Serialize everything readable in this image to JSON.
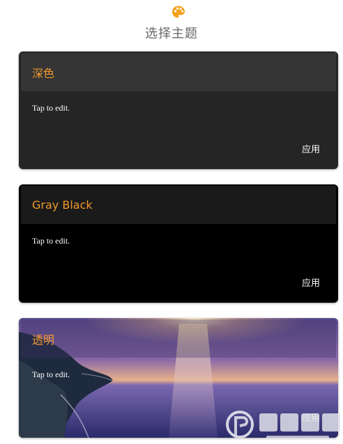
{
  "header": {
    "icon": "palette-icon",
    "title": "选择主题"
  },
  "themes": [
    {
      "title": "深色",
      "body": "Tap to edit.",
      "apply_label": "应用",
      "background": "#252525",
      "header_color": "#353535",
      "title_color": "#f29a2e"
    },
    {
      "title": "Gray Black",
      "body": "Tap to edit.",
      "apply_label": "应用",
      "background": "#000000",
      "header_color": "#1a1a1a",
      "title_color": "#f29a2e"
    },
    {
      "title": "透明",
      "body": "Tap to edit.",
      "apply_label": "应用",
      "background": "sunset-sea-image",
      "title_color": "#f29a2e"
    }
  ],
  "watermark": {
    "icon": "j9p-logo-icon"
  }
}
